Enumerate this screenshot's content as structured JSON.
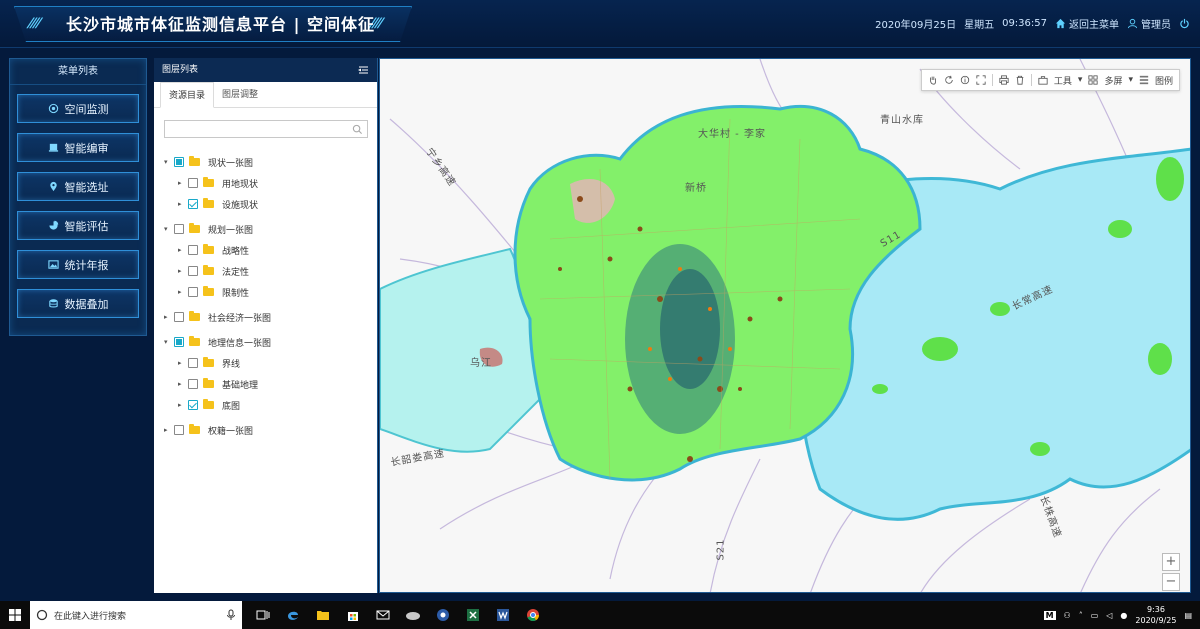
{
  "header": {
    "title": "长沙市城市体征监测信息平台 | 空间体征",
    "date": "2020年09月25日",
    "weekday": "星期五",
    "time": "09:36:57",
    "back_label": "返回主菜单",
    "user_label": "管理员"
  },
  "menu": {
    "title": "菜单列表",
    "items": [
      {
        "label": "空间监测",
        "icon": "globe-icon"
      },
      {
        "label": "智能编审",
        "icon": "document-icon"
      },
      {
        "label": "智能选址",
        "icon": "location-pin-icon"
      },
      {
        "label": "智能评估",
        "icon": "pie-chart-icon"
      },
      {
        "label": "统计年报",
        "icon": "image-icon"
      },
      {
        "label": "数据叠加",
        "icon": "database-icon"
      }
    ]
  },
  "layer_panel": {
    "title": "图层列表",
    "tabs": [
      "资源目录",
      "图层调整"
    ],
    "search_placeholder": "",
    "tree": [
      {
        "label": "现状一张图",
        "level": 0,
        "state": "partial",
        "expanded": true
      },
      {
        "label": "用地现状",
        "level": 1,
        "state": "unchecked"
      },
      {
        "label": "设施现状",
        "level": 1,
        "state": "checked"
      },
      {
        "label": "规划一张图",
        "level": 0,
        "state": "unchecked",
        "expanded": true
      },
      {
        "label": "战略性",
        "level": 1,
        "state": "unchecked"
      },
      {
        "label": "法定性",
        "level": 1,
        "state": "unchecked"
      },
      {
        "label": "限制性",
        "level": 1,
        "state": "unchecked"
      },
      {
        "label": "社会经济一张图",
        "level": 0,
        "state": "unchecked",
        "expanded": false
      },
      {
        "label": "地理信息一张图",
        "level": 0,
        "state": "partial",
        "expanded": true
      },
      {
        "label": "界线",
        "level": 1,
        "state": "unchecked"
      },
      {
        "label": "基础地理",
        "level": 1,
        "state": "unchecked"
      },
      {
        "label": "底图",
        "level": 1,
        "state": "checked"
      },
      {
        "label": "权籍一张图",
        "level": 0,
        "state": "unchecked",
        "expanded": false
      }
    ]
  },
  "map": {
    "toolbar": {
      "tools_label": "工具",
      "multiscreen_label": "多屏",
      "legend_label": "图例"
    },
    "labels": [
      "大华村 - 李家",
      "青山水库",
      "新桥",
      "宁乡高速",
      "长常高速",
      "长韶娄高速",
      "长株高速",
      "S21",
      "乌江",
      "S11"
    ],
    "zoom_in": "+",
    "zoom_out": "−"
  },
  "taskbar": {
    "search_placeholder": "在此键入进行搜索",
    "time": "9:36",
    "date": "2020/9/25",
    "ime_label": "M"
  }
}
